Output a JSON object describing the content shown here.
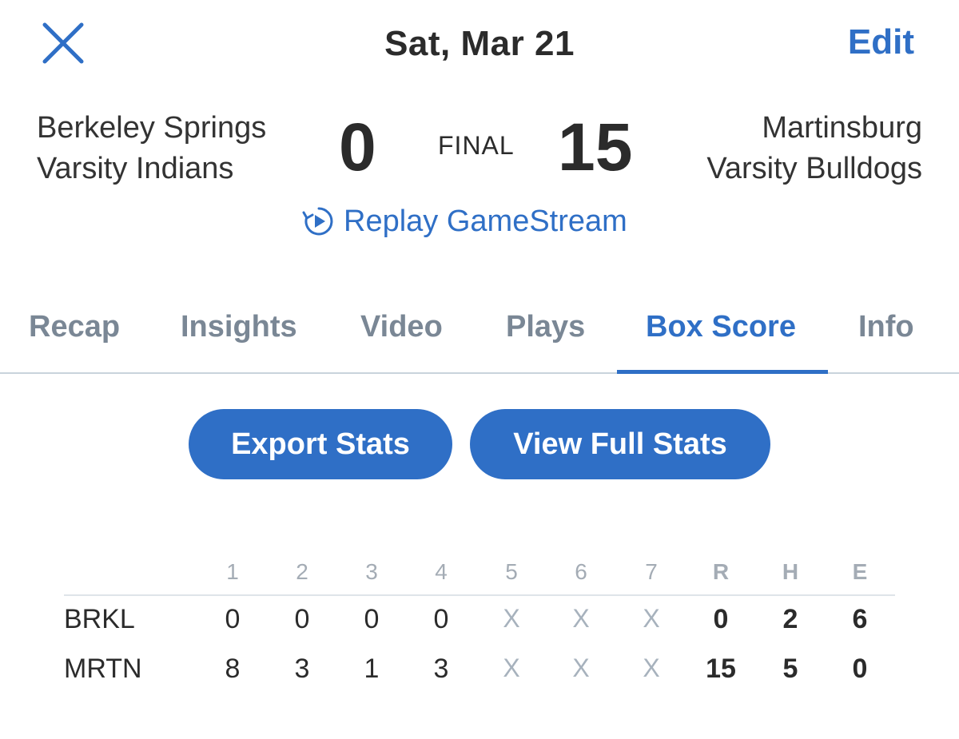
{
  "header": {
    "date": "Sat, Mar 21",
    "edit_label": "Edit",
    "close_icon": "close-icon"
  },
  "game": {
    "home_team": {
      "line1": "Berkeley Springs",
      "line2": "Varsity Indians",
      "score": "0"
    },
    "away_team": {
      "line1": "Martinsburg",
      "line2": "Varsity Bulldogs",
      "score": "15"
    },
    "status": "FINAL",
    "replay_label": "Replay GameStream",
    "replay_icon": "replay-icon"
  },
  "tabs": [
    {
      "label": "Recap"
    },
    {
      "label": "Insights"
    },
    {
      "label": "Video"
    },
    {
      "label": "Plays"
    },
    {
      "label": "Box Score",
      "active": true
    },
    {
      "label": "Info"
    }
  ],
  "actions": {
    "export_label": "Export Stats",
    "full_stats_label": "View Full Stats"
  },
  "linescore": {
    "columns": [
      "1",
      "2",
      "3",
      "4",
      "5",
      "6",
      "7",
      "R",
      "H",
      "E"
    ],
    "rows": [
      {
        "team": "BRKL",
        "innings": [
          "0",
          "0",
          "0",
          "0",
          "X",
          "X",
          "X"
        ],
        "R": "0",
        "H": "2",
        "E": "6"
      },
      {
        "team": "MRTN",
        "innings": [
          "8",
          "3",
          "1",
          "3",
          "X",
          "X",
          "X"
        ],
        "R": "15",
        "H": "5",
        "E": "0"
      }
    ]
  },
  "colors": {
    "accent": "#2f6fc6",
    "text": "#2b2b2b",
    "muted": "#7a8795"
  }
}
